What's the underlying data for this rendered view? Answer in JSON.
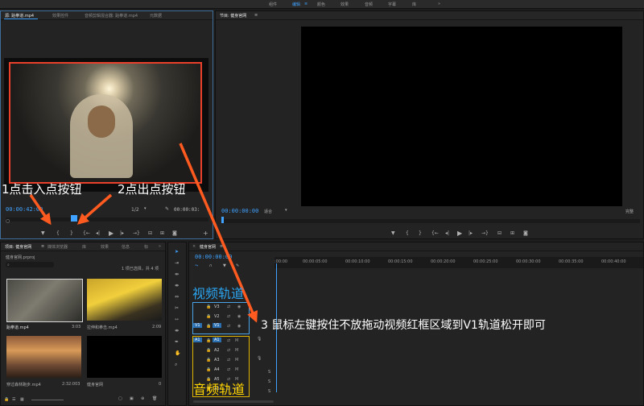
{
  "workspace_tabs": [
    "组件",
    "编辑",
    "颜色",
    "效果",
    "音频",
    "字幕",
    "库"
  ],
  "workspace_active": "编辑",
  "more_icon": "»",
  "source_panel": {
    "tabs": [
      "源: 跆拳道.mp4",
      "效果控件",
      "音频剪辑混合器: 跆拳道.mp4",
      "元数据"
    ],
    "timecode_in": "00:00:42:00",
    "zoom": "1/2",
    "timecode_out": "00:00:03:"
  },
  "program_panel": {
    "tab": "节目: 健身官网",
    "timecode": "00:00:00:00",
    "fit": "适合",
    "quality": "完整"
  },
  "project_panel": {
    "tabs": [
      "项目: 健身官网",
      "媒体浏览器",
      "库",
      "效果",
      "信息",
      "标"
    ],
    "project_file": "健身官网.prproj",
    "selection_info": "1 项已选择，共 4 项",
    "items": [
      {
        "name": "跆拳道.mp4",
        "duration": "3:03"
      },
      {
        "name": "拉伸和拳击.mp4",
        "duration": "2:09"
      },
      {
        "name": "穿过森林跑步.mp4",
        "duration": "2:32:003"
      },
      {
        "name": "健身官网",
        "duration": "0"
      }
    ]
  },
  "timeline_panel": {
    "tab": "健身官网",
    "timecode": "00:00:00:00",
    "ruler": [
      ":00:00",
      "00:00:05:00",
      "00:00:10:00",
      "00:00:15:00",
      "00:00:20:00",
      "00:00:25:00",
      "00:00:30:00",
      "00:00:35:00",
      "00:00:40:00"
    ],
    "video_tracks": [
      {
        "patch": "",
        "name": "V3"
      },
      {
        "patch": "",
        "name": "V2"
      },
      {
        "patch": "V1",
        "name": "V1"
      }
    ],
    "audio_tracks": [
      {
        "patch": "A1",
        "name": "A1"
      },
      {
        "patch": "",
        "name": "A2"
      },
      {
        "patch": "",
        "name": "A3"
      },
      {
        "patch": "",
        "name": "A4"
      },
      {
        "patch": "",
        "name": "A5"
      },
      {
        "patch": "",
        "name": "A6"
      }
    ],
    "mute_label": "M",
    "solo_label": "S",
    "eye_label": "◉",
    "lock_label": "🔒"
  },
  "annotations": {
    "step1": "1点击入点按钮",
    "step2": "2点出点按钮",
    "step3": "3 鼠标左键按住不放拖动视频红框区域到V1轨道松开即可",
    "video_track_label": "视频轨道",
    "audio_track_label": "音频轨道"
  },
  "colors": {
    "accent_blue": "#3fa2ff",
    "arrow_orange": "#ff5a1f",
    "frame_red": "#e8402a",
    "video_box": "#4aa3e6",
    "audio_box": "#e0b400",
    "video_label": "#2aa4ef",
    "audio_label": "#ffd400"
  }
}
